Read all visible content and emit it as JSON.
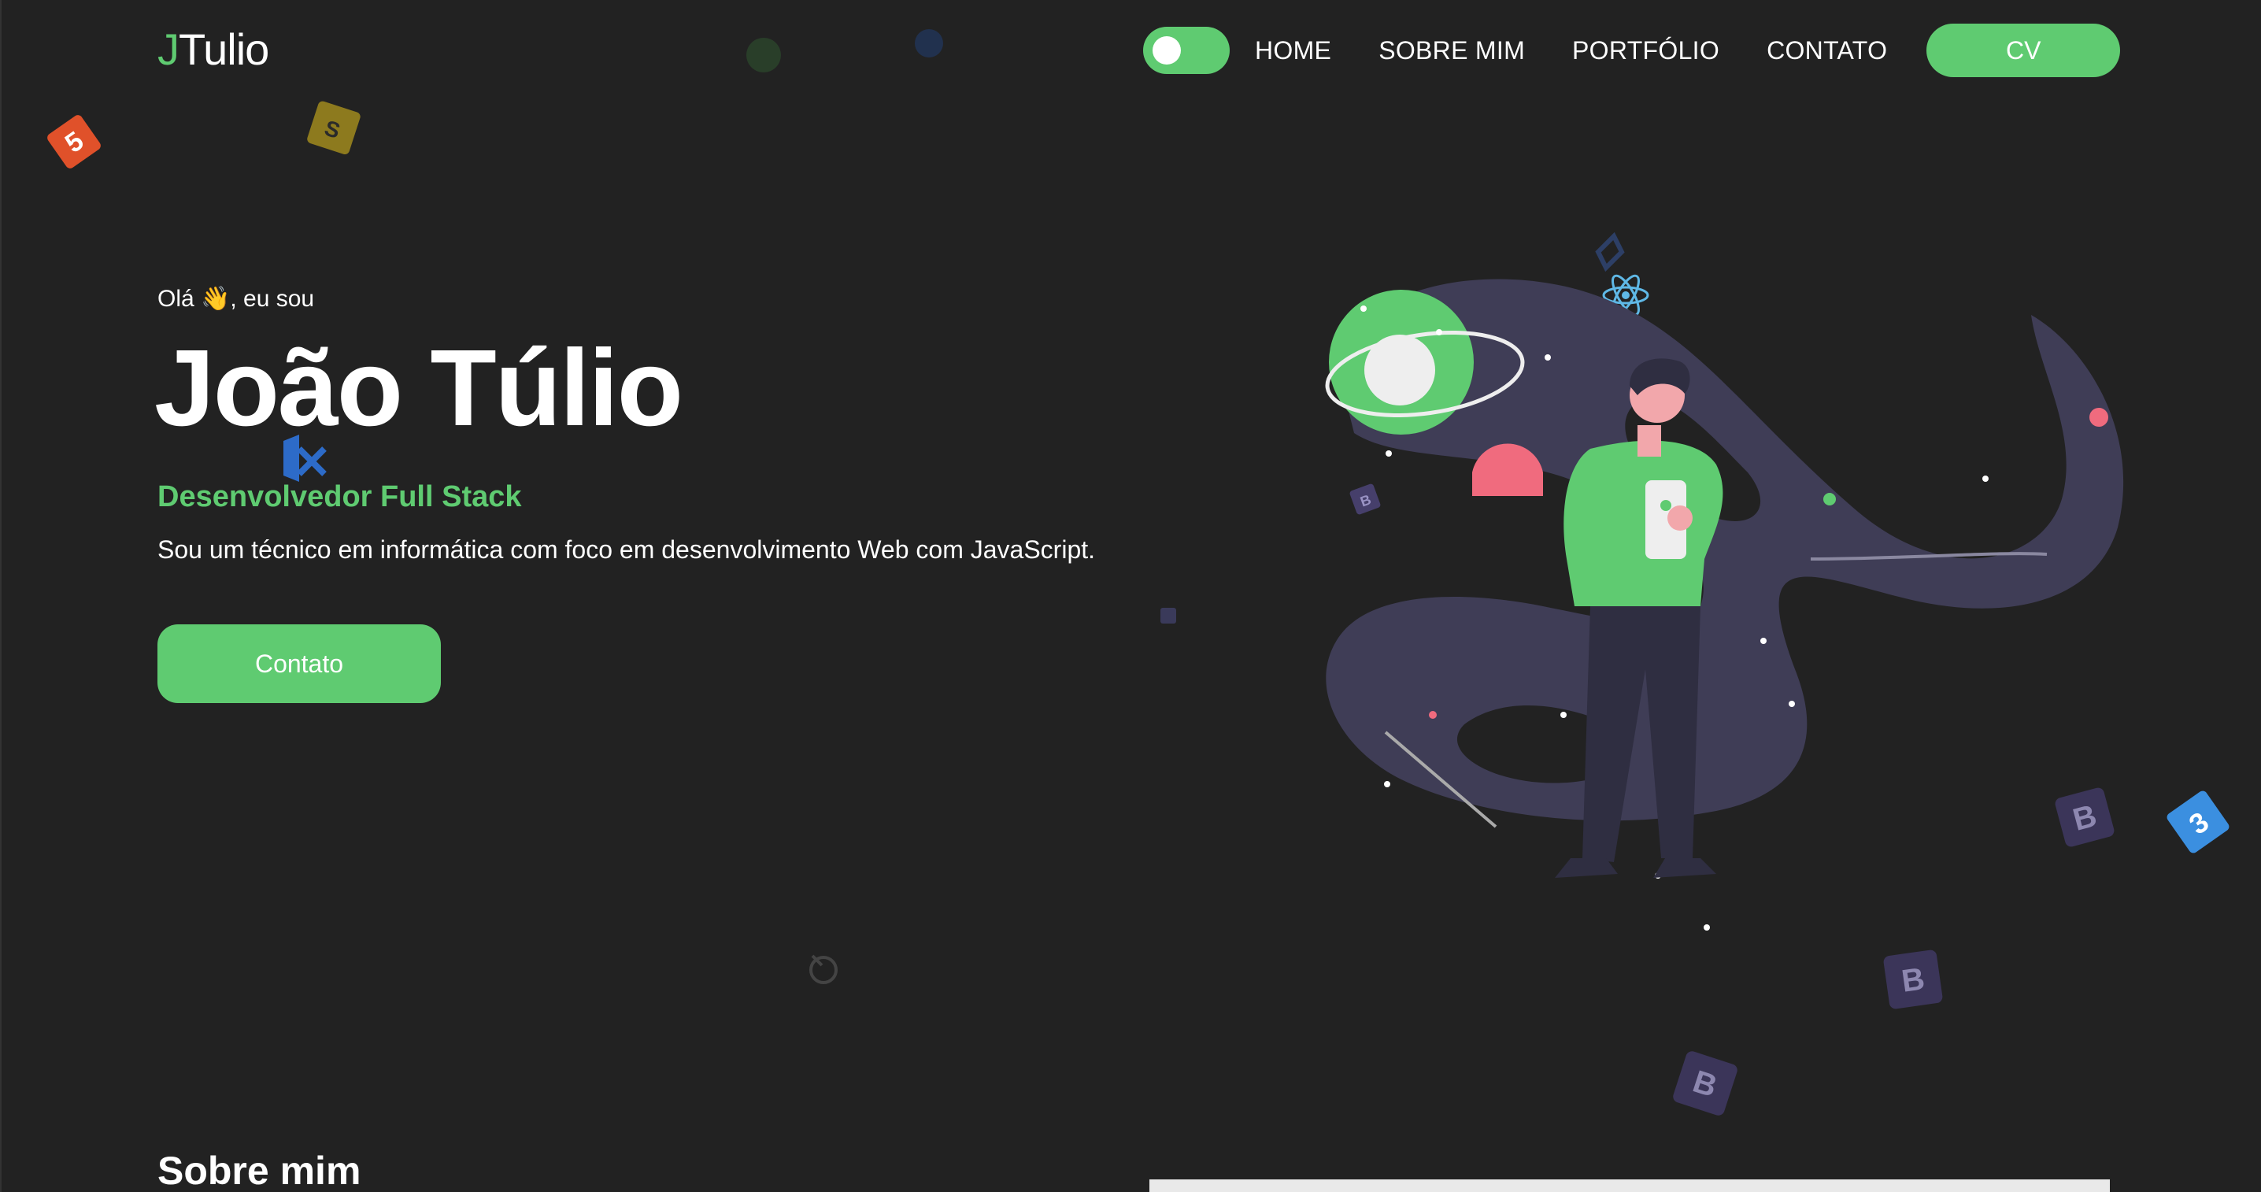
{
  "header": {
    "logo_initial": "J",
    "logo_rest": "Tulio",
    "theme_toggle_state": "on",
    "nav": [
      "HOME",
      "SOBRE MIM",
      "PORTFÓLIO",
      "CONTATO"
    ],
    "cv_label": "CV"
  },
  "hero": {
    "greeting": "Olá 👋, eu sou",
    "name": "João Túlio",
    "role": "Desenvolvedor Full Stack",
    "description": "Sou um técnico em informática com foco em desenvolvimento Web com JavaScript.",
    "contact_label": "Contato"
  },
  "about": {
    "title": "Sobre mim"
  },
  "colors": {
    "background": "#222222",
    "accent": "#5fcb71",
    "text": "#ffffff",
    "illustration_shape": "#3f3d56",
    "pink": "#f06b7e"
  },
  "icons": [
    "html5-icon",
    "sass-icon",
    "react-icon",
    "bootstrap-icon",
    "css3-icon",
    "vscode-icon",
    "nodejs-icon"
  ]
}
